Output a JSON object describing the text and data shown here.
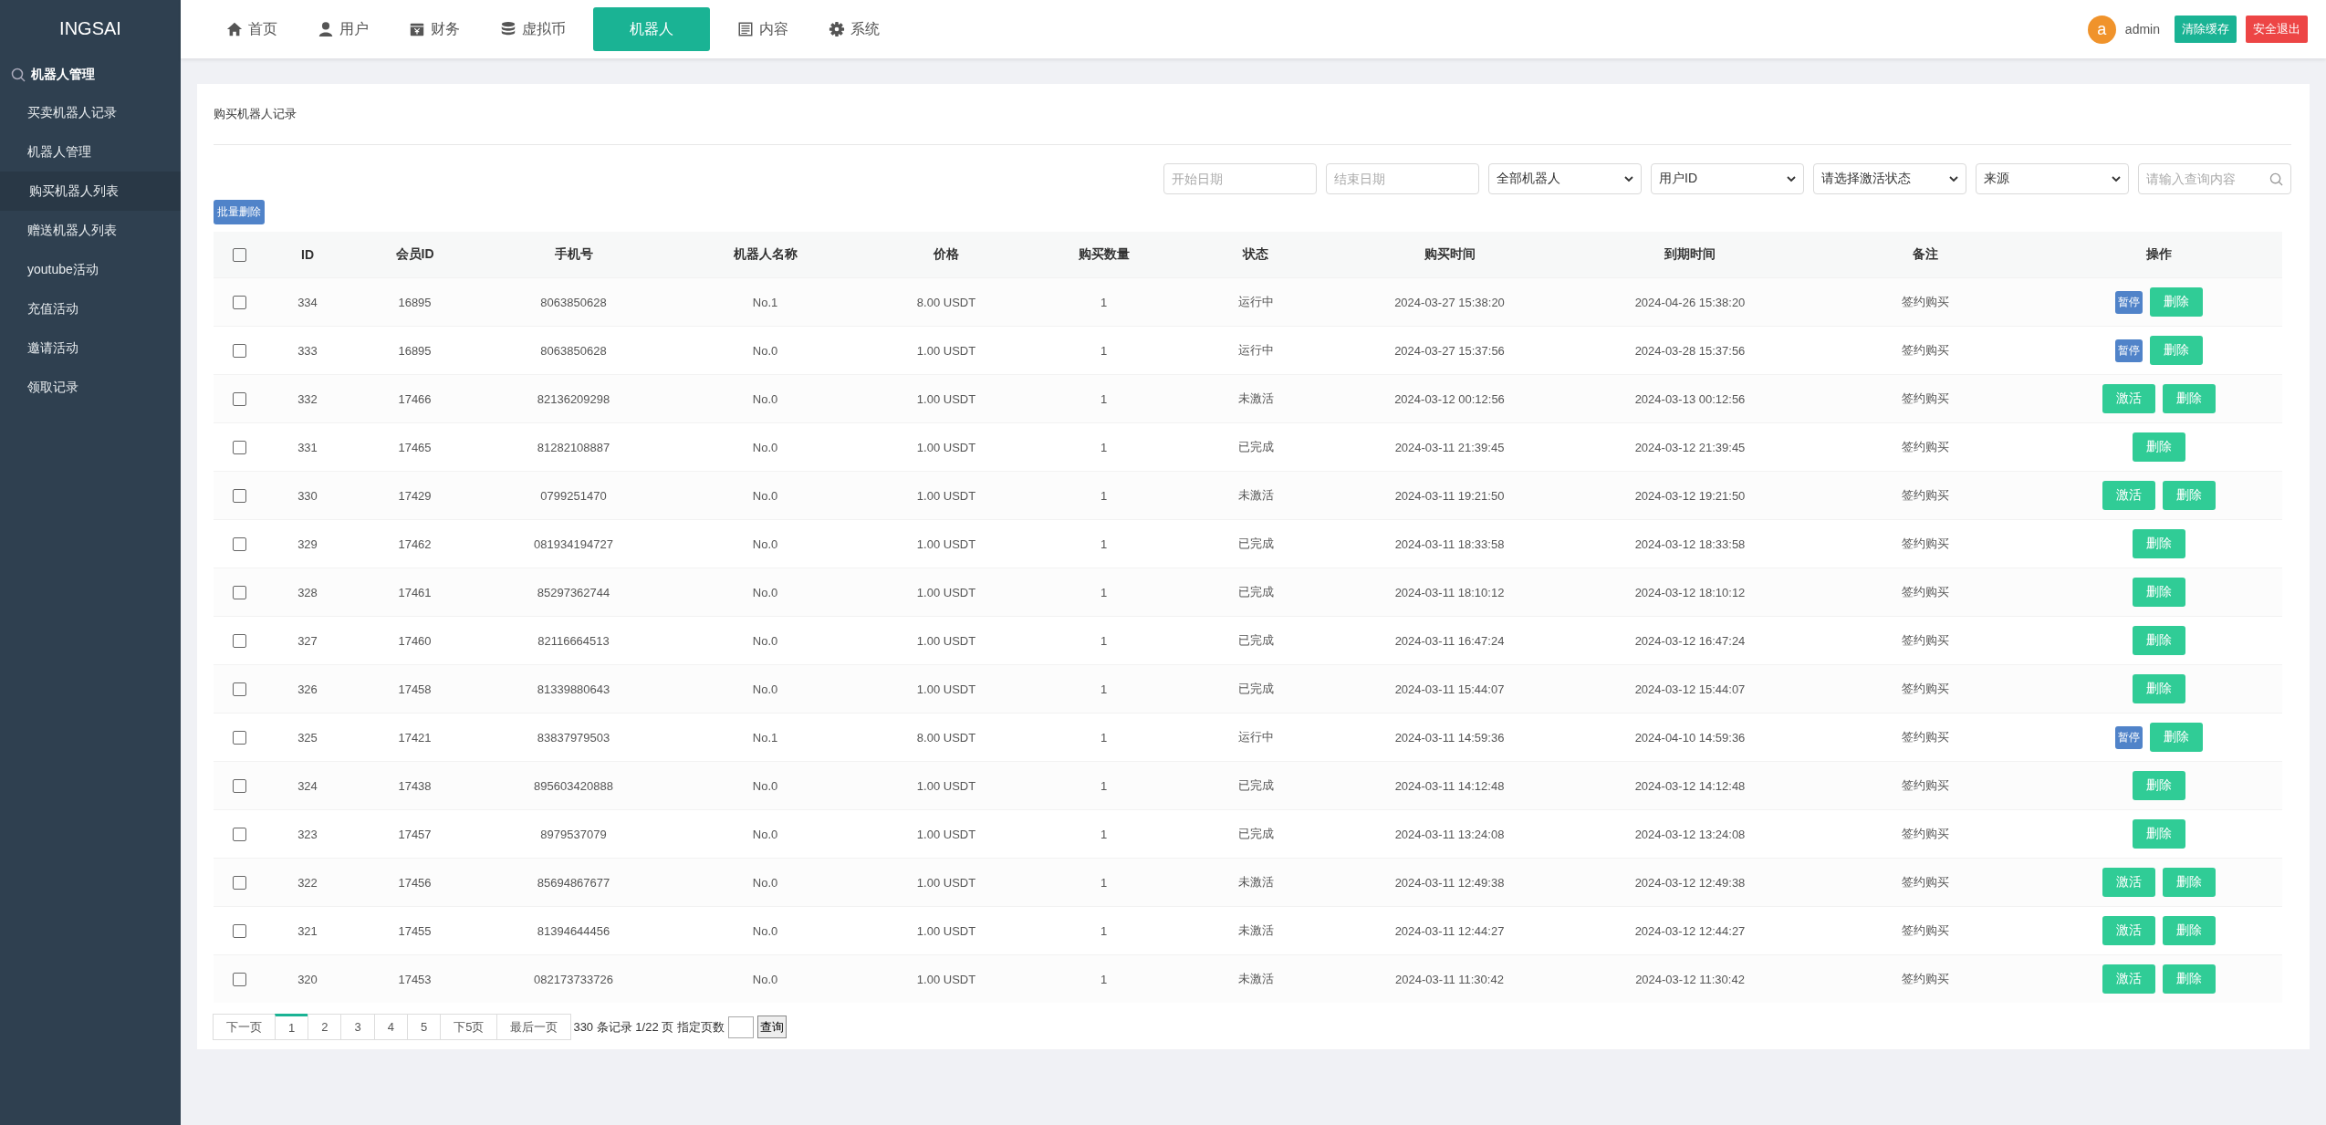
{
  "brand": "INGSAI",
  "nav": [
    {
      "label": "首页",
      "kind": "home",
      "selected": false
    },
    {
      "label": "用户",
      "kind": "user",
      "selected": false
    },
    {
      "label": "财务",
      "kind": "finance",
      "selected": false
    },
    {
      "label": "虚拟币",
      "kind": "coins",
      "selected": false
    },
    {
      "label": "机器人",
      "kind": "plain",
      "selected": true
    },
    {
      "label": "内容",
      "kind": "doc",
      "selected": false
    },
    {
      "label": "系统",
      "kind": "gear",
      "selected": false
    }
  ],
  "user": {
    "avatar": "a",
    "name": "admin",
    "buttons": [
      {
        "label": "清除缓存",
        "kind": "green"
      },
      {
        "label": "安全退出",
        "kind": "red"
      }
    ]
  },
  "sidebar": {
    "title": "机器人管理",
    "items": [
      {
        "label": "买卖机器人记录",
        "selected": false
      },
      {
        "label": "机器人管理",
        "selected": false
      },
      {
        "label": "购买机器人列表",
        "selected": true
      },
      {
        "label": "赠送机器人列表",
        "selected": false
      },
      {
        "label": "youtube活动",
        "selected": false
      },
      {
        "label": "充值活动",
        "selected": false
      },
      {
        "label": "邀请活动",
        "selected": false
      },
      {
        "label": "领取记录",
        "selected": false
      }
    ]
  },
  "page_title": "购买机器人记录",
  "filters": [
    {
      "kind": "date",
      "placeholder": "开始日期"
    },
    {
      "kind": "date",
      "placeholder": "结束日期"
    },
    {
      "kind": "select",
      "value": "全部机器人"
    },
    {
      "kind": "select",
      "value": "用户ID"
    },
    {
      "kind": "select",
      "value": "请选择激活状态"
    },
    {
      "kind": "select",
      "value": "来源"
    },
    {
      "kind": "search",
      "placeholder": "请输入查询内容"
    }
  ],
  "batch_delete": "批量删除",
  "table": {
    "select_all": false,
    "columns": [
      "ID",
      "会员ID",
      "手机号",
      "机器人名称",
      "价格",
      "购买数量",
      "状态",
      "购买时间",
      "到期时间",
      "备注",
      "操作"
    ],
    "rows": [
      {
        "checked": false,
        "cells": [
          "334",
          "16895",
          "8063850628",
          "No.1",
          "8.00 USDT",
          "1",
          "运行中",
          "2024-03-27 15:38:20",
          "2024-04-26 15:38:20",
          "签约购买"
        ],
        "actions": [
          {
            "label": "暂停",
            "kind": "pause"
          },
          {
            "label": "删除",
            "kind": "delete"
          }
        ]
      },
      {
        "checked": false,
        "cells": [
          "333",
          "16895",
          "8063850628",
          "No.0",
          "1.00 USDT",
          "1",
          "运行中",
          "2024-03-27 15:37:56",
          "2024-03-28 15:37:56",
          "签约购买"
        ],
        "actions": [
          {
            "label": "暂停",
            "kind": "pause"
          },
          {
            "label": "删除",
            "kind": "delete"
          }
        ]
      },
      {
        "checked": false,
        "cells": [
          "332",
          "17466",
          "82136209298",
          "No.0",
          "1.00 USDT",
          "1",
          "未激活",
          "2024-03-12 00:12:56",
          "2024-03-13 00:12:56",
          "签约购买"
        ],
        "actions": [
          {
            "label": "激活",
            "kind": "activate"
          },
          {
            "label": "删除",
            "kind": "delete"
          }
        ]
      },
      {
        "checked": false,
        "cells": [
          "331",
          "17465",
          "81282108887",
          "No.0",
          "1.00 USDT",
          "1",
          "已完成",
          "2024-03-11 21:39:45",
          "2024-03-12 21:39:45",
          "签约购买"
        ],
        "actions": [
          {
            "label": "删除",
            "kind": "delete"
          }
        ]
      },
      {
        "checked": false,
        "cells": [
          "330",
          "17429",
          "0799251470",
          "No.0",
          "1.00 USDT",
          "1",
          "未激活",
          "2024-03-11 19:21:50",
          "2024-03-12 19:21:50",
          "签约购买"
        ],
        "actions": [
          {
            "label": "激活",
            "kind": "activate"
          },
          {
            "label": "删除",
            "kind": "delete"
          }
        ]
      },
      {
        "checked": false,
        "cells": [
          "329",
          "17462",
          "081934194727",
          "No.0",
          "1.00 USDT",
          "1",
          "已完成",
          "2024-03-11 18:33:58",
          "2024-03-12 18:33:58",
          "签约购买"
        ],
        "actions": [
          {
            "label": "删除",
            "kind": "delete"
          }
        ]
      },
      {
        "checked": false,
        "cells": [
          "328",
          "17461",
          "85297362744",
          "No.0",
          "1.00 USDT",
          "1",
          "已完成",
          "2024-03-11 18:10:12",
          "2024-03-12 18:10:12",
          "签约购买"
        ],
        "actions": [
          {
            "label": "删除",
            "kind": "delete"
          }
        ]
      },
      {
        "checked": false,
        "cells": [
          "327",
          "17460",
          "82116664513",
          "No.0",
          "1.00 USDT",
          "1",
          "已完成",
          "2024-03-11 16:47:24",
          "2024-03-12 16:47:24",
          "签约购买"
        ],
        "actions": [
          {
            "label": "删除",
            "kind": "delete"
          }
        ]
      },
      {
        "checked": false,
        "cells": [
          "326",
          "17458",
          "81339880643",
          "No.0",
          "1.00 USDT",
          "1",
          "已完成",
          "2024-03-11 15:44:07",
          "2024-03-12 15:44:07",
          "签约购买"
        ],
        "actions": [
          {
            "label": "删除",
            "kind": "delete"
          }
        ]
      },
      {
        "checked": false,
        "cells": [
          "325",
          "17421",
          "83837979503",
          "No.1",
          "8.00 USDT",
          "1",
          "运行中",
          "2024-03-11 14:59:36",
          "2024-04-10 14:59:36",
          "签约购买"
        ],
        "actions": [
          {
            "label": "暂停",
            "kind": "pause"
          },
          {
            "label": "删除",
            "kind": "delete"
          }
        ]
      },
      {
        "checked": false,
        "cells": [
          "324",
          "17438",
          "895603420888",
          "No.0",
          "1.00 USDT",
          "1",
          "已完成",
          "2024-03-11 14:12:48",
          "2024-03-12 14:12:48",
          "签约购买"
        ],
        "actions": [
          {
            "label": "删除",
            "kind": "delete"
          }
        ]
      },
      {
        "checked": false,
        "cells": [
          "323",
          "17457",
          "8979537079",
          "No.0",
          "1.00 USDT",
          "1",
          "已完成",
          "2024-03-11 13:24:08",
          "2024-03-12 13:24:08",
          "签约购买"
        ],
        "actions": [
          {
            "label": "删除",
            "kind": "delete"
          }
        ]
      },
      {
        "checked": false,
        "cells": [
          "322",
          "17456",
          "85694867677",
          "No.0",
          "1.00 USDT",
          "1",
          "未激活",
          "2024-03-11 12:49:38",
          "2024-03-12 12:49:38",
          "签约购买"
        ],
        "actions": [
          {
            "label": "激活",
            "kind": "activate"
          },
          {
            "label": "删除",
            "kind": "delete"
          }
        ]
      },
      {
        "checked": false,
        "cells": [
          "321",
          "17455",
          "81394644456",
          "No.0",
          "1.00 USDT",
          "1",
          "未激活",
          "2024-03-11 12:44:27",
          "2024-03-12 12:44:27",
          "签约购买"
        ],
        "actions": [
          {
            "label": "激活",
            "kind": "activate"
          },
          {
            "label": "删除",
            "kind": "delete"
          }
        ]
      },
      {
        "checked": false,
        "cells": [
          "320",
          "17453",
          "082173733726",
          "No.0",
          "1.00 USDT",
          "1",
          "未激活",
          "2024-03-11 11:30:42",
          "2024-03-12 11:30:42",
          "签约购买"
        ],
        "actions": [
          {
            "label": "激活",
            "kind": "activate"
          },
          {
            "label": "删除",
            "kind": "delete"
          }
        ]
      }
    ]
  },
  "pagination": {
    "prev": "下一页",
    "pages": [
      {
        "label": "1",
        "selected": true
      },
      {
        "label": "2",
        "selected": false
      },
      {
        "label": "3",
        "selected": false
      },
      {
        "label": "4",
        "selected": false
      },
      {
        "label": "5",
        "selected": false
      }
    ],
    "next5": "下5页",
    "last": "最后一页",
    "info": "330 条记录 1/22 页 指定页数",
    "go": "查询"
  }
}
